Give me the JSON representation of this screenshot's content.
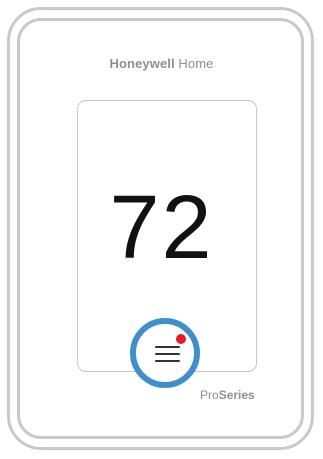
{
  "brand": {
    "name_bold": "Honeywell",
    "name_light": " Home"
  },
  "display": {
    "temperature": "72"
  },
  "menu": {
    "icon": "hamburger-menu-icon",
    "has_notification": true,
    "notification_color": "#e5192a",
    "ring_color": "#3f8fce"
  },
  "series": {
    "prefix": "Pro",
    "suffix": "Series"
  }
}
